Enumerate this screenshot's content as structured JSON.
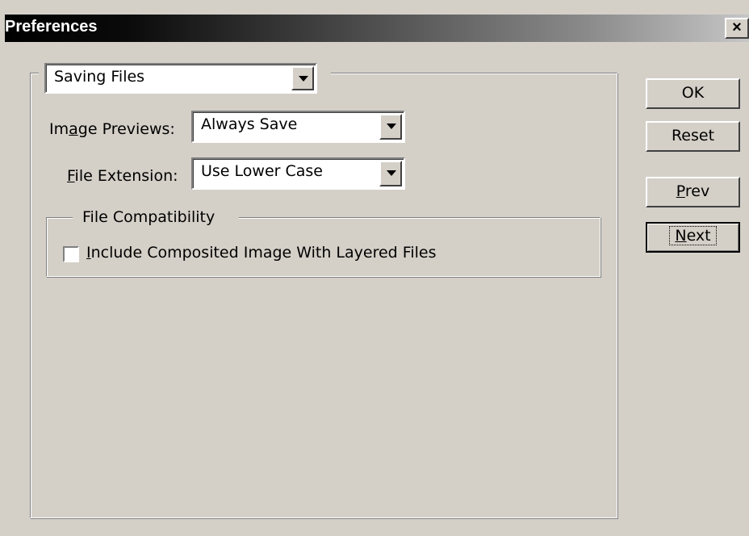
{
  "window": {
    "title": "Preferences",
    "close_symbol": "×"
  },
  "category": {
    "selected": "Saving Files"
  },
  "image_previews": {
    "label_pre": "Im",
    "label_accel": "a",
    "label_post": "ge Previews:",
    "value": "Always Save"
  },
  "file_extension": {
    "label_accel": "F",
    "label_post": "ile Extension:",
    "value": "Use Lower Case"
  },
  "file_compatibility": {
    "legend": "File Compatibility",
    "include_composite": {
      "accel": "I",
      "label_post": "nclude Composited Image With Layered Files",
      "checked": false
    }
  },
  "buttons": {
    "ok": "OK",
    "reset": "Reset",
    "prev_accel": "P",
    "prev_post": "rev",
    "next_accel": "N",
    "next_post": "ext"
  }
}
